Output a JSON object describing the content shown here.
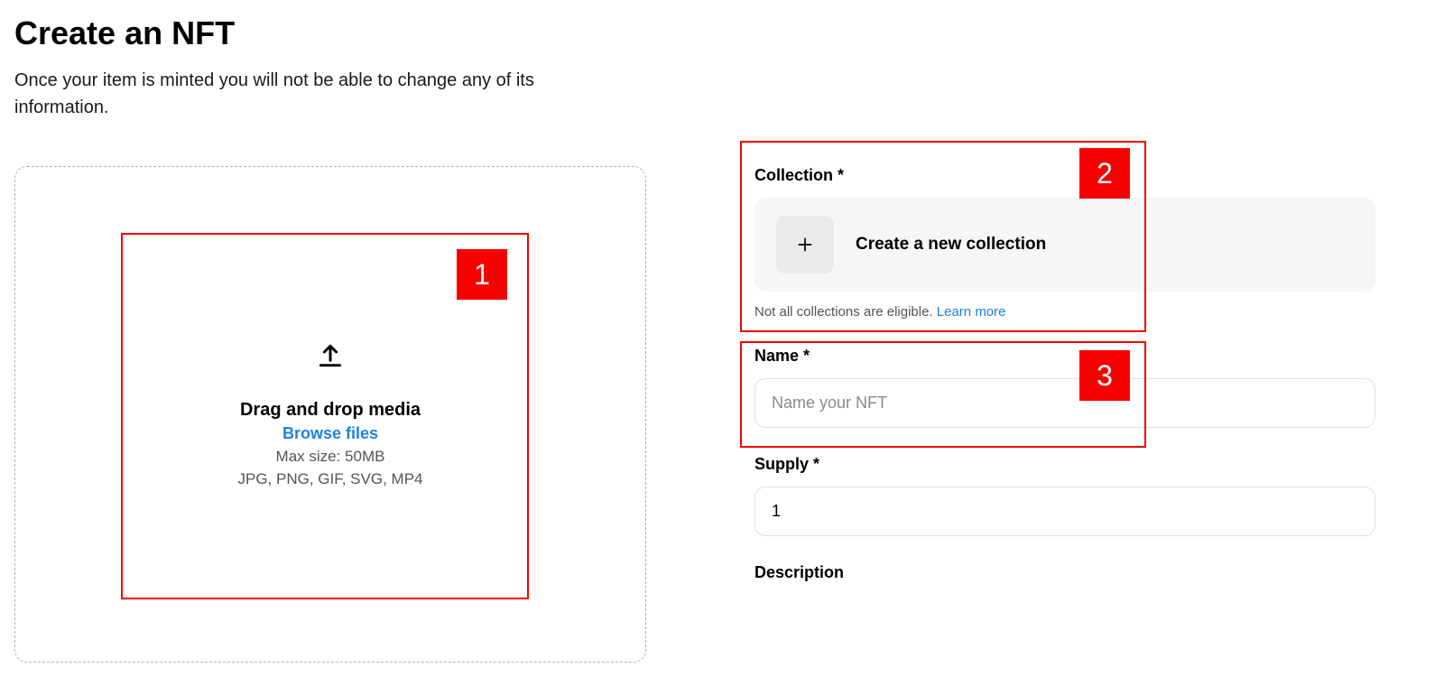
{
  "header": {
    "title": "Create an NFT",
    "subtitle": "Once your item is minted you will not be able to change any of its information."
  },
  "dropzone": {
    "main_text": "Drag and drop media",
    "browse_text": "Browse files",
    "max_size_text": "Max size: 50MB",
    "formats_text": "JPG, PNG, GIF, SVG, MP4"
  },
  "collection": {
    "label": "Collection *",
    "create_text": "Create a new collection",
    "help_prefix": "Not all collections are eligible. ",
    "help_link": "Learn more"
  },
  "name": {
    "label": "Name *",
    "placeholder": "Name your NFT"
  },
  "supply": {
    "label": "Supply *",
    "value": "1"
  },
  "description": {
    "label": "Description"
  },
  "markers": {
    "m1": "1",
    "m2": "2",
    "m3": "3"
  }
}
